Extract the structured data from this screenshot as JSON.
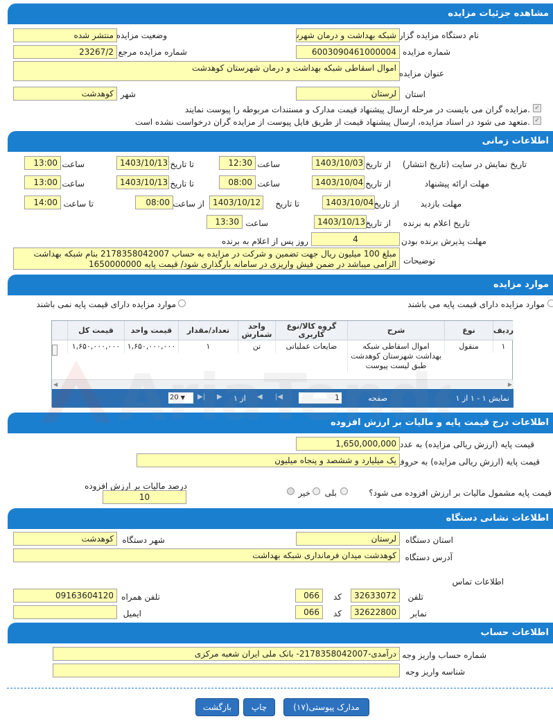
{
  "sections": {
    "details": "مشاهده جزئیات مزایده",
    "timing": "اطلاعات زمانی",
    "items": "موارد مزایده",
    "pricing": "اطلاعات درج قیمت پایه و مالیات بر ارزش افزوده",
    "agency": "اطلاعات نشانی دستگاه",
    "account": "اطلاعات حساب"
  },
  "details": {
    "org_label": "نام دستگاه مزایده گزار",
    "org_value": "شبکه بهداشت و درمان شهرستان کوهدشت",
    "status_label": "وضعیت مزایده",
    "status_value": "منتشر شده",
    "auction_no_label": "شماره مزایده",
    "auction_no_value": "6003090461000004",
    "ref_no_label": "شماره مزایده مرجع",
    "ref_no_value": "23267/2",
    "title_label": "عنوان مزایده",
    "title_value": "اموال اسقاطی شبکه بهداشت و درمان شهرستان کوهدشت",
    "province_label": "استان",
    "province_value": "لرستان",
    "city_label": "شهر",
    "city_value": "کوهدشت",
    "check1": "مزایده گران می بایست در مرحله ارسال پیشنهاد قیمت مدارک و مستندات مربوطه را پیوست نمایند.",
    "check2": "متعهد می شود در اسناد مزایده، ارسال پیشنهاد قیمت از طریق فایل پیوست از مزایده گران درخواست نشده است."
  },
  "timing": {
    "publish_label": "تاریخ نمایش در سایت (تاریخ انتشار)",
    "offer_label": "مهلت ارائه پیشنهاد",
    "visit_label": "مهلت بازدید",
    "winner_label": "تاریخ اعلام به برنده",
    "accept_label": "مهلت پذیرش برنده بودن",
    "desc_label": "توضیحات",
    "from_date": "از تاریخ",
    "to_date": "تا تاریخ",
    "time": "ساعت",
    "from_time": "از ساعت",
    "to_time": "تا ساعت",
    "days_after": "روز پس از اعلام به برنده",
    "publish_from": "1403/10/03",
    "publish_from_time": "12:30",
    "publish_to": "1403/10/13",
    "publish_to_time": "13:00",
    "offer_from": "1403/10/04",
    "offer_from_time": "08:00",
    "offer_to": "1403/10/13",
    "offer_to_time": "13:00",
    "visit_from": "1403/10/04",
    "visit_to": "1403/10/12",
    "visit_from_time": "08:00",
    "visit_to_time": "14:00",
    "winner_date": "1403/10/13",
    "winner_time": "13:30",
    "accept_days": "4",
    "description": "مبلغ 100 میلیون ریال جهت تضمین و شرکت در مزایده به حساب 2178358042007 بنام شبکه بهداشت الزامی میباشد در ضمن فیش واریزی در سامانه بارگذاری شود/ قیمت پایه 1650000000"
  },
  "items": {
    "radio_with_base": "موارد مزایده دارای قیمت پایه می باشند",
    "radio_without_base": "موارد مزایده دارای قیمت پایه نمی باشند",
    "columns": [
      "ردیف",
      "نوع",
      "شرح",
      "گروه کالا/نوع کاربری",
      "واحد شمارش",
      "تعداد/مقدار",
      "قیمت واحد",
      "قیمت کل"
    ],
    "rows": [
      {
        "row": "۱",
        "type": "منقول",
        "desc": "اموال اسقاطی شبکه بهداشت شهرستان کوهدشت طبق لیست پیوست",
        "group": "ضایعات عملیاتی",
        "unit": "تن",
        "qty": "۱",
        "unit_price": "۱,۶۵۰,۰۰۰,۰۰۰",
        "total": "۱,۶۵۰,۰۰۰,۰۰۰"
      }
    ],
    "pager": {
      "summary": "نمایش ۱ - ۱ از ۱",
      "page_label": "صفحه",
      "page_value": "1",
      "of_label": "از ۱",
      "page_size": "20"
    }
  },
  "pricing": {
    "base_num_label": "قیمت پایه (ارزش ریالی مزایده) به عدد",
    "base_num_value": "1,650,000,000",
    "base_word_label": "قیمت پایه (ارزش ریالی مزایده) به حروف",
    "base_word_value": "یک میلیارد و ششصد و پنجاه میلیون",
    "vat_q_label": "قیمت پایه مشمول مالیات بر ارزش افزوده می شود؟",
    "yes": "بلی",
    "no": "خیر",
    "vat_pct_label": "درصد مالیات بر ارزش افزوده",
    "vat_pct_value": "10"
  },
  "agency": {
    "province_label": "استان دستگاه",
    "province_value": "لرستان",
    "city_label": "شهر دستگاه",
    "city_value": "کوهدشت",
    "address_label": "آدرس دستگاه",
    "address_value": "کوهدشت میدان فرمانداری شبکه بهداشت",
    "contact_label": "اطلاعات تماس",
    "phone_label": "تلفن",
    "phone_value": "32633072",
    "code_label": "کد",
    "phone_code": "066",
    "mobile_label": "تلفن همراه",
    "mobile_value": "09163604120",
    "fax_label": "نمابر",
    "fax_value": "32622800",
    "fax_code": "066",
    "email_label": "ایمیل",
    "email_value": ""
  },
  "account": {
    "account_label": "شماره حساب واریز وجه",
    "account_value": "درآمدی-2178358042007- بانک ملی ایران شعبه مرکزی",
    "id_label": "شناسه واریز وجه",
    "id_value": ""
  },
  "buttons": {
    "docs": "مدارک پیوستی(۱۷)",
    "print": "چاپ",
    "back": "بازگشت"
  },
  "watermark": "AriaTender.net"
}
